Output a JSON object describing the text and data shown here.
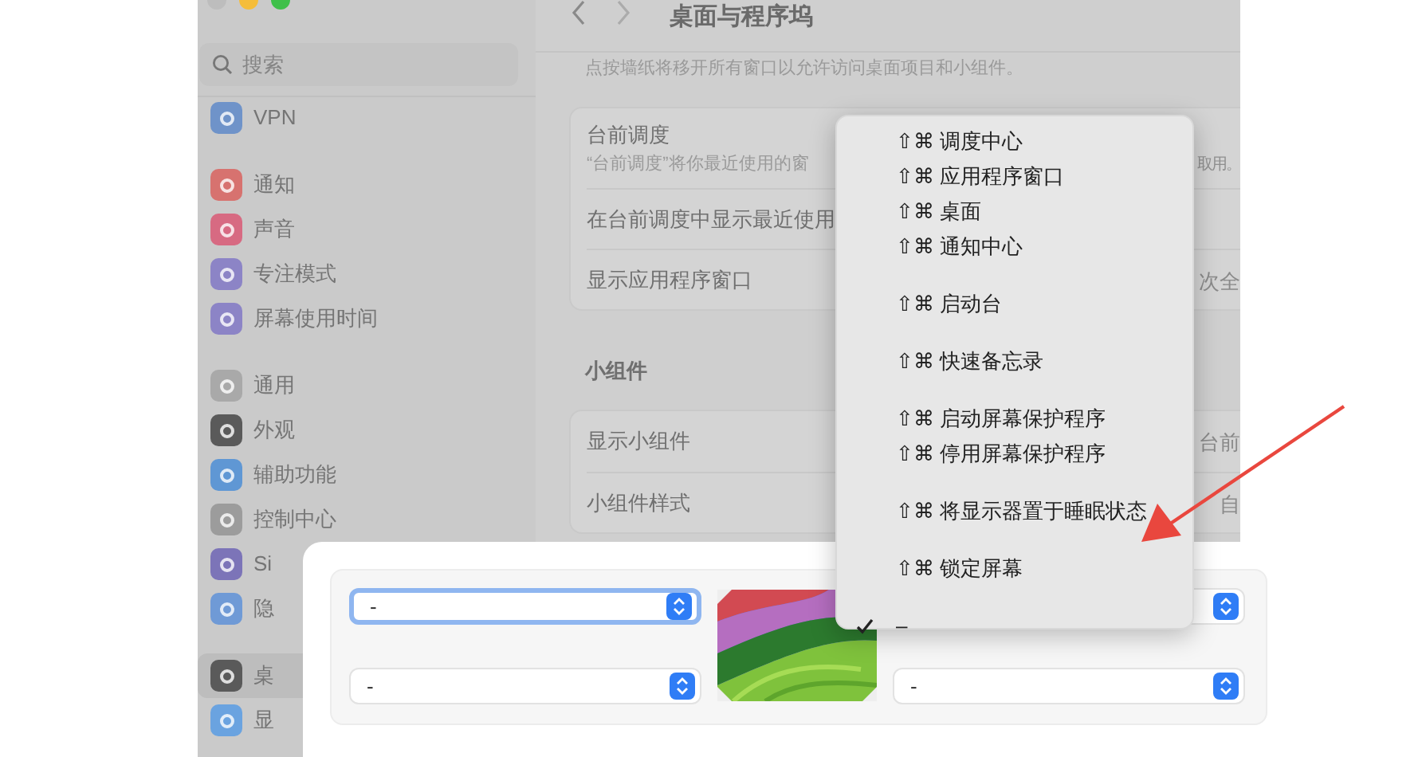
{
  "window": {
    "title": "桌面与程序坞"
  },
  "sidebar": {
    "search_placeholder": "搜索",
    "groups": [
      [
        {
          "label": "VPN",
          "color": "#6f93c9",
          "selected": false
        }
      ],
      [
        {
          "label": "通知",
          "color": "#d7726f",
          "selected": false
        },
        {
          "label": "声音",
          "color": "#d76a82",
          "selected": false
        },
        {
          "label": "专注模式",
          "color": "#8c84c6",
          "selected": false
        },
        {
          "label": "屏幕使用时间",
          "color": "#8c84c6",
          "selected": false
        }
      ],
      [
        {
          "label": "通用",
          "color": "#a9a9a9",
          "selected": false
        },
        {
          "label": "外观",
          "color": "#5a5a5a",
          "selected": false
        },
        {
          "label": "辅助功能",
          "color": "#5f97d4",
          "selected": false
        },
        {
          "label": "控制中心",
          "color": "#9c9c9c",
          "selected": false
        },
        {
          "label": "Si",
          "color": "#7c74b8",
          "selected": false
        },
        {
          "label": "隐",
          "color": "#6f9ad6",
          "selected": false
        }
      ],
      [
        {
          "label": "桌",
          "color": "#5a5a5a",
          "selected": true
        },
        {
          "label": "显",
          "color": "#6aa3e0",
          "selected": false
        }
      ]
    ]
  },
  "content": {
    "note": "点按墙纸将移开所有窗口以允许访问桌面项目和小组件。",
    "cards": [
      {
        "rows": [
          {
            "label": "台前调度",
            "subtitle": "“台前调度”将你最近使用的窗",
            "subtitle_tail": "取用。"
          },
          {
            "label": "在台前调度中显示最近使用"
          },
          {
            "label": "显示应用程序窗口",
            "value": "次全"
          }
        ]
      },
      {
        "heading": "小组件",
        "rows": [
          {
            "label": "显示小组件",
            "value": "台前"
          },
          {
            "label": "小组件样式",
            "value": "自"
          }
        ]
      }
    ]
  },
  "hot_corners": {
    "dropdowns": [
      {
        "value": "-",
        "focused": true
      },
      {
        "focused": false
      },
      {
        "value": "-",
        "focused": false
      },
      {
        "value": "-",
        "focused": false
      }
    ]
  },
  "menu": [
    {
      "kind": "item",
      "shortcut": "⇧⌘",
      "label": "调度中心",
      "checked": false
    },
    {
      "kind": "item",
      "shortcut": "⇧⌘",
      "label": "应用程序窗口",
      "checked": false
    },
    {
      "kind": "item",
      "shortcut": "⇧⌘",
      "label": "桌面",
      "checked": false
    },
    {
      "kind": "item",
      "shortcut": "⇧⌘",
      "label": "通知中心",
      "checked": false
    },
    {
      "kind": "separator"
    },
    {
      "kind": "item",
      "shortcut": "⇧⌘",
      "label": "启动台",
      "checked": false
    },
    {
      "kind": "separator"
    },
    {
      "kind": "item",
      "shortcut": "⇧⌘",
      "label": "快速备忘录",
      "checked": false
    },
    {
      "kind": "separator"
    },
    {
      "kind": "item",
      "shortcut": "⇧⌘",
      "label": "启动屏幕保护程序",
      "checked": false
    },
    {
      "kind": "item",
      "shortcut": "⇧⌘",
      "label": "停用屏幕保护程序",
      "checked": false
    },
    {
      "kind": "separator"
    },
    {
      "kind": "item",
      "shortcut": "⇧⌘",
      "label": "将显示器置于睡眠状态",
      "checked": false
    },
    {
      "kind": "separator"
    },
    {
      "kind": "item",
      "shortcut": "⇧⌘",
      "label": "锁定屏幕",
      "checked": false
    },
    {
      "kind": "separator"
    },
    {
      "kind": "item",
      "label": "–",
      "checked": true
    }
  ]
}
